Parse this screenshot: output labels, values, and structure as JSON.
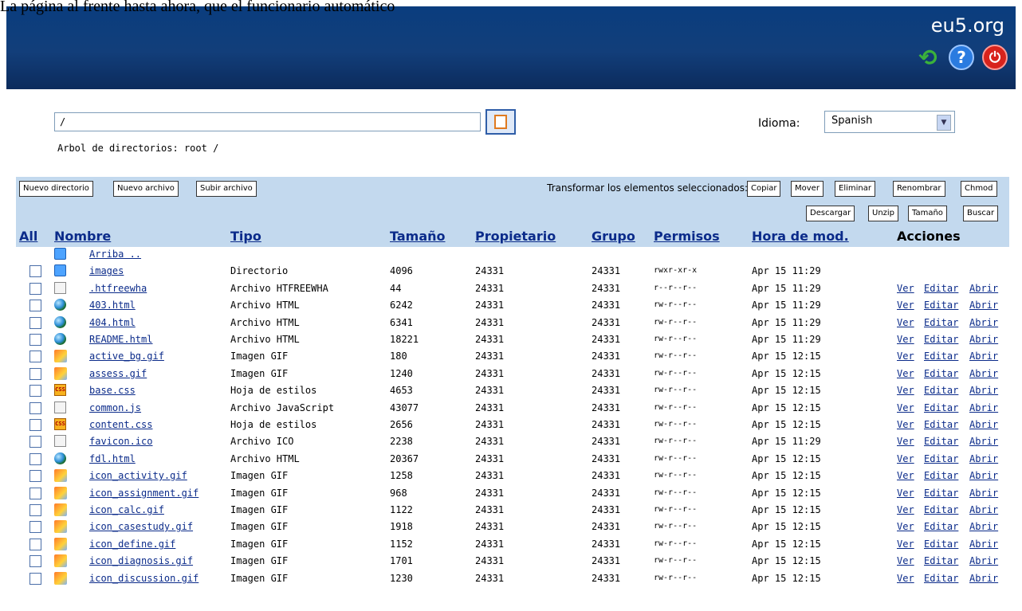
{
  "top_text": "La página al frente hasta ahora, que el funcionario automático",
  "header": {
    "brand": "eu5.org"
  },
  "path": {
    "value": "/"
  },
  "tree": {
    "label": "Arbol de directorios: root /"
  },
  "language": {
    "label": "Idioma:",
    "selected": "Spanish"
  },
  "toolbar": {
    "new_dir": "Nuevo directorio",
    "new_file": "Nuevo archivo",
    "upload": "Subir archivo",
    "transform_label": "Transformar los elementos seleccionados:",
    "copy": "Copiar",
    "move": "Mover",
    "delete": "Eliminar",
    "rename": "Renombrar",
    "chmod": "Chmod",
    "download": "Descargar",
    "unzip": "Unzip",
    "size": "Tamaño",
    "search": "Buscar"
  },
  "columns": {
    "all": "All",
    "name": "Nombre",
    "type": "Tipo",
    "size": "Tamaño",
    "owner": "Propietario",
    "group": "Grupo",
    "perms": "Permisos",
    "modified": "Hora de mod.",
    "actions": "Acciones"
  },
  "actions": {
    "view": "Ver",
    "edit": "Editar",
    "open": "Abrir"
  },
  "rows": [
    {
      "icon": "folder",
      "name": "Arriba ..",
      "type": "",
      "size": "",
      "owner": "",
      "group": "",
      "perms": "",
      "time": "",
      "actions": false,
      "checkbox": false
    },
    {
      "icon": "folder",
      "name": "images",
      "type": "Directorio",
      "size": "4096",
      "owner": "24331",
      "group": "24331",
      "perms": "rwxr-xr-x",
      "time": "Apr 15 11:29",
      "actions": false,
      "checkbox": true
    },
    {
      "icon": "blank",
      "name": ".htfreewha",
      "type": "Archivo HTFREEWHA",
      "size": "44",
      "owner": "24331",
      "group": "24331",
      "perms": "r--r--r--",
      "time": "Apr 15 11:29",
      "actions": true,
      "checkbox": true
    },
    {
      "icon": "globe",
      "name": "403.html",
      "type": "Archivo HTML",
      "size": "6242",
      "owner": "24331",
      "group": "24331",
      "perms": "rw-r--r--",
      "time": "Apr 15 11:29",
      "actions": true,
      "checkbox": true
    },
    {
      "icon": "globe",
      "name": "404.html",
      "type": "Archivo HTML",
      "size": "6341",
      "owner": "24331",
      "group": "24331",
      "perms": "rw-r--r--",
      "time": "Apr 15 11:29",
      "actions": true,
      "checkbox": true
    },
    {
      "icon": "globe",
      "name": "README.html",
      "type": "Archivo HTML",
      "size": "18221",
      "owner": "24331",
      "group": "24331",
      "perms": "rw-r--r--",
      "time": "Apr 15 11:29",
      "actions": true,
      "checkbox": true
    },
    {
      "icon": "gif",
      "name": "active_bg.gif",
      "type": "Imagen GIF",
      "size": "180",
      "owner": "24331",
      "group": "24331",
      "perms": "rw-r--r--",
      "time": "Apr 15 12:15",
      "actions": true,
      "checkbox": true
    },
    {
      "icon": "gif",
      "name": "assess.gif",
      "type": "Imagen GIF",
      "size": "1240",
      "owner": "24331",
      "group": "24331",
      "perms": "rw-r--r--",
      "time": "Apr 15 12:15",
      "actions": true,
      "checkbox": true
    },
    {
      "icon": "css",
      "name": "base.css",
      "type": "Hoja de estilos",
      "size": "4653",
      "owner": "24331",
      "group": "24331",
      "perms": "rw-r--r--",
      "time": "Apr 15 12:15",
      "actions": true,
      "checkbox": true
    },
    {
      "icon": "blank",
      "name": "common.js",
      "type": "Archivo JavaScript",
      "size": "43077",
      "owner": "24331",
      "group": "24331",
      "perms": "rw-r--r--",
      "time": "Apr 15 12:15",
      "actions": true,
      "checkbox": true
    },
    {
      "icon": "css",
      "name": "content.css",
      "type": "Hoja de estilos",
      "size": "2656",
      "owner": "24331",
      "group": "24331",
      "perms": "rw-r--r--",
      "time": "Apr 15 12:15",
      "actions": true,
      "checkbox": true
    },
    {
      "icon": "blank",
      "name": "favicon.ico",
      "type": "Archivo ICO",
      "size": "2238",
      "owner": "24331",
      "group": "24331",
      "perms": "rw-r--r--",
      "time": "Apr 15 11:29",
      "actions": true,
      "checkbox": true
    },
    {
      "icon": "globe",
      "name": "fdl.html",
      "type": "Archivo HTML",
      "size": "20367",
      "owner": "24331",
      "group": "24331",
      "perms": "rw-r--r--",
      "time": "Apr 15 12:15",
      "actions": true,
      "checkbox": true
    },
    {
      "icon": "gif",
      "name": "icon_activity.gif",
      "type": "Imagen GIF",
      "size": "1258",
      "owner": "24331",
      "group": "24331",
      "perms": "rw-r--r--",
      "time": "Apr 15 12:15",
      "actions": true,
      "checkbox": true
    },
    {
      "icon": "gif",
      "name": "icon_assignment.gif",
      "type": "Imagen GIF",
      "size": "968",
      "owner": "24331",
      "group": "24331",
      "perms": "rw-r--r--",
      "time": "Apr 15 12:15",
      "actions": true,
      "checkbox": true
    },
    {
      "icon": "gif",
      "name": "icon_calc.gif",
      "type": "Imagen GIF",
      "size": "1122",
      "owner": "24331",
      "group": "24331",
      "perms": "rw-r--r--",
      "time": "Apr 15 12:15",
      "actions": true,
      "checkbox": true
    },
    {
      "icon": "gif",
      "name": "icon_casestudy.gif",
      "type": "Imagen GIF",
      "size": "1918",
      "owner": "24331",
      "group": "24331",
      "perms": "rw-r--r--",
      "time": "Apr 15 12:15",
      "actions": true,
      "checkbox": true
    },
    {
      "icon": "gif",
      "name": "icon_define.gif",
      "type": "Imagen GIF",
      "size": "1152",
      "owner": "24331",
      "group": "24331",
      "perms": "rw-r--r--",
      "time": "Apr 15 12:15",
      "actions": true,
      "checkbox": true
    },
    {
      "icon": "gif",
      "name": "icon_diagnosis.gif",
      "type": "Imagen GIF",
      "size": "1701",
      "owner": "24331",
      "group": "24331",
      "perms": "rw-r--r--",
      "time": "Apr 15 12:15",
      "actions": true,
      "checkbox": true
    },
    {
      "icon": "gif",
      "name": "icon_discussion.gif",
      "type": "Imagen GIF",
      "size": "1230",
      "owner": "24331",
      "group": "24331",
      "perms": "rw-r--r--",
      "time": "Apr 15 12:15",
      "actions": true,
      "checkbox": true
    }
  ]
}
